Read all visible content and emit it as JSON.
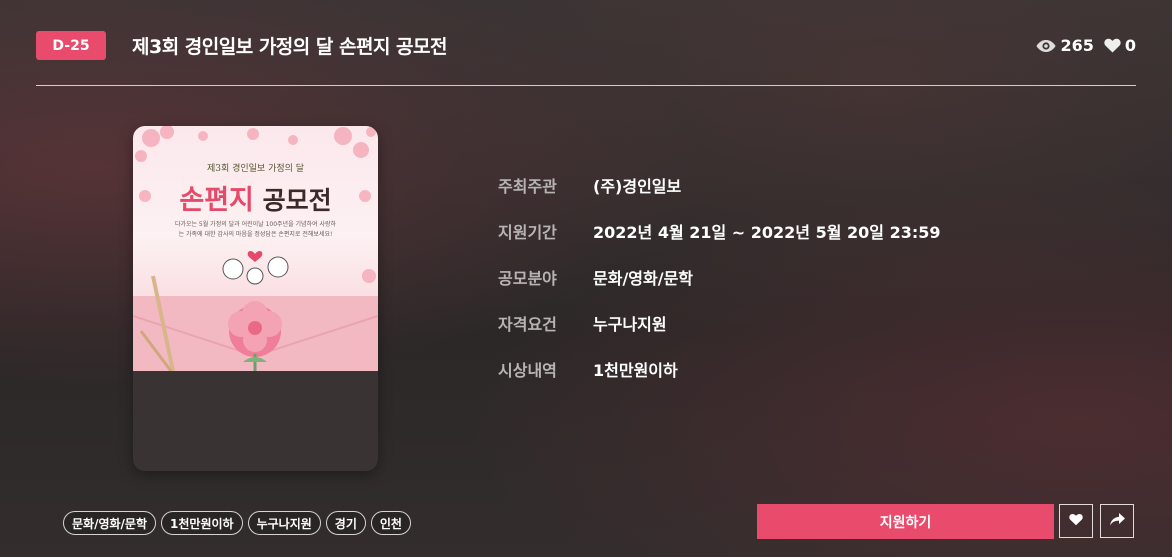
{
  "header": {
    "dday": "D-25",
    "title": "제3회 경인일보 가정의 달 손편지 공모전",
    "views": "265",
    "likes": "0"
  },
  "poster": {
    "subtitle": "제3회 경인일보 가정의 달",
    "title_pink": "손편지",
    "title_dark": "공모전",
    "description": "다가오는 5월 가정의 달과 어린이날 100주년을 기념하여 사랑하는 가족에 대한 감사의 마음을 정성담은 손편지로 전해보세요!"
  },
  "info": [
    {
      "label": "주최주관",
      "value": "(주)경인일보"
    },
    {
      "label": "지원기간",
      "value": "2022년 4월 21일 ~ 2022년 5월 20일 23:59"
    },
    {
      "label": "공모분야",
      "value": "문화/영화/문학"
    },
    {
      "label": "자격요건",
      "value": "누구나지원"
    },
    {
      "label": "시상내역",
      "value": "1천만원이하"
    }
  ],
  "tags": [
    "문화/영화/문학",
    "1천만원이하",
    "누구나지원",
    "경기",
    "인천"
  ],
  "actions": {
    "apply_label": "지원하기",
    "like_icon": "heart-icon",
    "share_icon": "share-icon"
  },
  "colors": {
    "accent": "#e94b6c",
    "background": "#2f2b2b"
  }
}
